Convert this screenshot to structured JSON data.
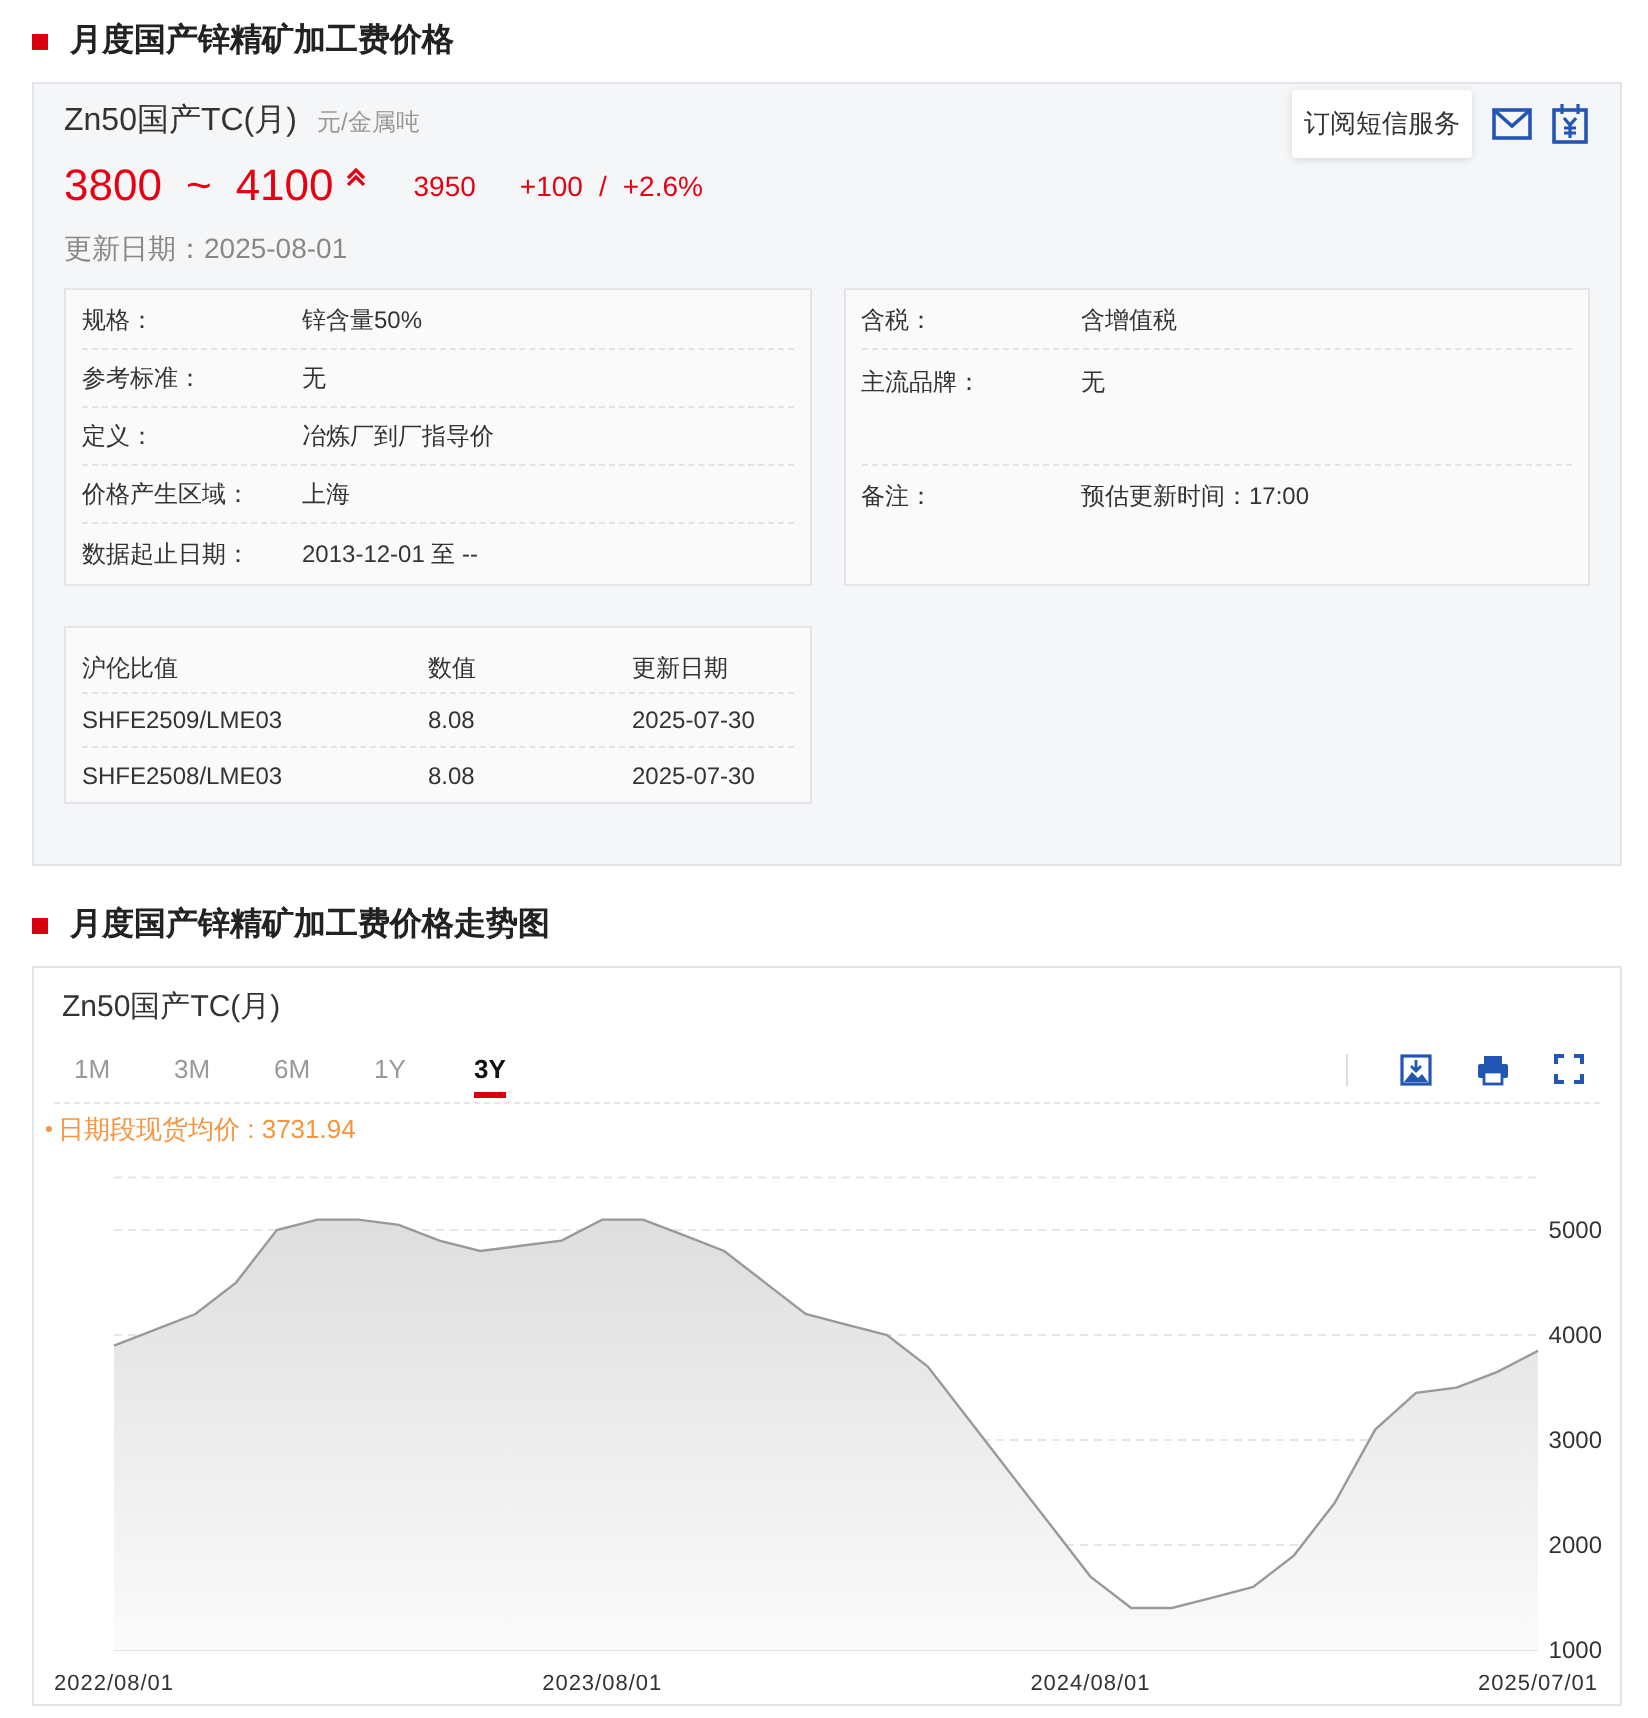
{
  "price_section": {
    "title": "月度国产锌精矿加工费价格",
    "product": {
      "name": "Zn50国产TC(月)",
      "unit": "元/金属吨"
    },
    "subscribe_button": "订阅短信服务",
    "price": {
      "low": "3800",
      "separator": "~",
      "high": "4100",
      "rising": true,
      "average": "3950",
      "change": "+100",
      "change_separator": "/",
      "change_percent": "+2.6%"
    },
    "update_date": "更新日期：2025-08-01",
    "specs_left": [
      {
        "label": "规格：",
        "value": "锌含量50%"
      },
      {
        "label": "参考标准：",
        "value": "无"
      },
      {
        "label": "定义：",
        "value": "冶炼厂到厂指导价"
      },
      {
        "label": "价格产生区域：",
        "value": "上海"
      },
      {
        "label": "数据起止日期：",
        "value": "2013-12-01 至 --"
      }
    ],
    "specs_right": [
      {
        "label": "含税：",
        "value": "含增值税"
      },
      {
        "label": "主流品牌：",
        "value": "无"
      },
      {
        "label": "备注：",
        "value": "预估更新时间：17:00"
      }
    ],
    "ratio_table": {
      "columns": [
        "沪伦比值",
        "数值",
        "更新日期"
      ],
      "rows": [
        [
          "SHFE2509/LME03",
          "8.08",
          "2025-07-30"
        ],
        [
          "SHFE2508/LME03",
          "8.08",
          "2025-07-30"
        ]
      ]
    }
  },
  "chart_section": {
    "title": "月度国产锌精矿加工费价格走势图",
    "chart_title": "Zn50国产TC(月)",
    "ranges": [
      {
        "label": "1M",
        "selected": false
      },
      {
        "label": "3M",
        "selected": false
      },
      {
        "label": "6M",
        "selected": false
      },
      {
        "label": "1Y",
        "selected": false
      },
      {
        "label": "3Y",
        "selected": true
      }
    ],
    "legend": "日期段现货均价 : 3731.94",
    "chart_data": {
      "type": "area",
      "categories": [
        "2022/08/01",
        null,
        null,
        null,
        null,
        null,
        null,
        null,
        null,
        null,
        null,
        null,
        "2023/08/01",
        null,
        null,
        null,
        null,
        null,
        null,
        null,
        null,
        null,
        null,
        null,
        "2024/08/01",
        null,
        null,
        null,
        null,
        null,
        null,
        null,
        null,
        null,
        null,
        "2025/07/01"
      ],
      "series": [
        {
          "color": "#999999",
          "values": [
            3900,
            4050,
            4200,
            4500,
            5000,
            5100,
            5100,
            5050,
            4900,
            4800,
            4850,
            4900,
            5100,
            5100,
            4950,
            4800,
            4500,
            4200,
            4100,
            4000,
            3700,
            3200,
            2700,
            2200,
            1700,
            1400,
            1400,
            1500,
            1600,
            1900,
            2400,
            3100,
            3450,
            3500,
            3650,
            3850
          ]
        }
      ],
      "ylim": [
        1000,
        5500
      ],
      "yticks": [
        1000,
        2000,
        3000,
        4000,
        5000
      ],
      "grid": true
    }
  }
}
